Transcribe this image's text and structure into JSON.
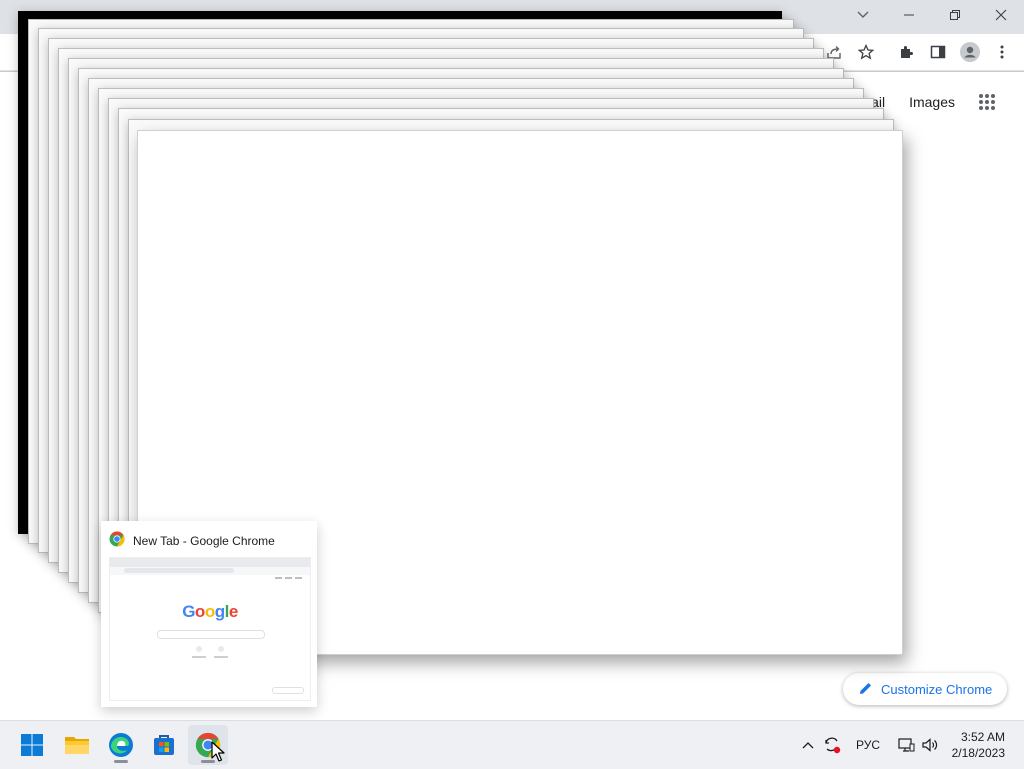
{
  "window": {
    "title": "New Tab - Google Chrome",
    "controls": [
      "tab-search",
      "minimize",
      "restore",
      "close"
    ]
  },
  "toolbar": {
    "icons": [
      "share-icon",
      "bookmark-star-icon",
      "extensions-icon",
      "side-panel-icon",
      "profile-icon",
      "menu-icon"
    ]
  },
  "ntp": {
    "links": [
      "Gmail",
      "Images"
    ],
    "apps_icon": "apps-grid-icon",
    "customize_label": "Customize Chrome"
  },
  "thumbnail": {
    "title": "New Tab - Google Chrome",
    "preview_logo": "Google"
  },
  "taskbar": {
    "apps": [
      {
        "name": "start",
        "icon": "windows-start-icon"
      },
      {
        "name": "file-explorer",
        "icon": "folder-icon"
      },
      {
        "name": "edge",
        "icon": "edge-icon"
      },
      {
        "name": "store",
        "icon": "store-icon"
      },
      {
        "name": "chrome",
        "icon": "chrome-icon",
        "active": true
      }
    ],
    "tray": {
      "language": "РУС",
      "time": "3:52 AM",
      "date": "2/18/2023"
    }
  },
  "colors": {
    "accent": "#1a73e8",
    "google_blue": "#4285f4",
    "google_red": "#ea4335",
    "google_yellow": "#fbbc05",
    "google_green": "#34a853",
    "taskbar_bg": "#eef0f4"
  }
}
